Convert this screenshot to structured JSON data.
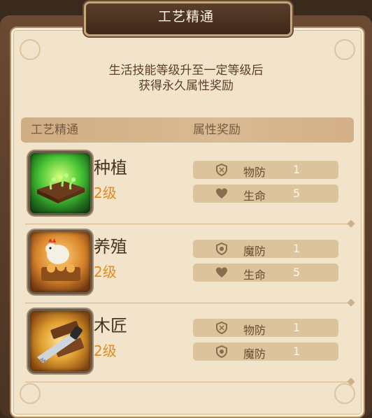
{
  "window": {
    "title": "工艺精通"
  },
  "description": {
    "line1": "生活技能等级升至一定等级后",
    "line2": "获得永久属性奖励"
  },
  "table": {
    "col_skill": "工艺精通",
    "col_reward": "属性奖励"
  },
  "skills": [
    {
      "name": "种植",
      "level": "2级",
      "icon": "sprout-icon",
      "attrs": [
        {
          "icon": "shield-icon",
          "name": "物防",
          "value": "1"
        },
        {
          "icon": "heart-icon",
          "name": "生命",
          "value": "5"
        }
      ]
    },
    {
      "name": "养殖",
      "level": "2级",
      "icon": "chicken-icon",
      "attrs": [
        {
          "icon": "magic-shield-icon",
          "name": "魔防",
          "value": "1"
        },
        {
          "icon": "heart-icon",
          "name": "生命",
          "value": "5"
        }
      ]
    },
    {
      "name": "木匠",
      "level": "2级",
      "icon": "saw-icon",
      "attrs": [
        {
          "icon": "shield-icon",
          "name": "物防",
          "value": "1"
        },
        {
          "icon": "magic-shield-icon",
          "name": "魔防",
          "value": "1"
        }
      ]
    }
  ],
  "colors": {
    "level": "#e38a1e",
    "panel": "#f1e4cb",
    "attr_bg": "#dbc39c"
  }
}
